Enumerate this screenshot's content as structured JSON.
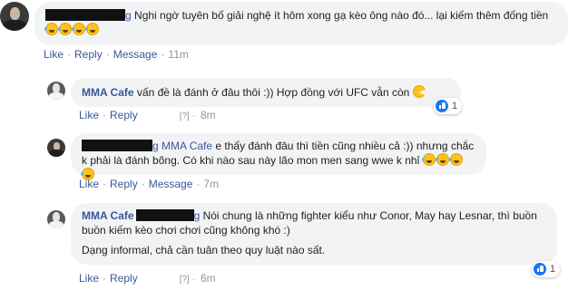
{
  "comments": [
    {
      "text": "Nghi ngờ tuyên bố giải nghệ ít hôm xong gạ kèo ông nào đó... lại kiếm thêm đống tiền",
      "emoji": [
        "rofl",
        "rofl",
        "rofl",
        "rofl"
      ],
      "actions": {
        "like": "Like",
        "reply": "Reply",
        "message": "Message",
        "time": "11m"
      }
    },
    {
      "author": "MMA Cafe",
      "text": "vấn đề là đánh ở đâu thôi :)) Hợp đồng với UFC vẫn còn",
      "emoji": [
        "pacman"
      ],
      "actions": {
        "like": "Like",
        "reply": "Reply",
        "translate_hint": "[?] ·",
        "time": "8m"
      },
      "reaction": {
        "icon": "like-icon",
        "count": "1"
      }
    },
    {
      "tag_suffix": "g",
      "tag": "MMA Cafe",
      "text": "e thấy đánh đâu thì tiền cũng nhiều cả :)) nhưng chắc k phải là đánh bõng. Có khi nào sau này lão mon men sang wwe k nhỉ",
      "emoji": [
        "rofl",
        "rofl",
        "rofl",
        "rofl"
      ],
      "actions": {
        "like": "Like",
        "reply": "Reply",
        "message": "Message",
        "time": "7m"
      }
    },
    {
      "author": "MMA Cafe",
      "tag_suffix": "g",
      "text": "Nói chung là những fighter kiểu như Conor, May hay Lesnar, thì buồn buồn kiếm kèo chơi chơi cũng không khó :)",
      "text2": "Dạng informal, chả cần tuân theo quy luật nào sất.",
      "actions": {
        "like": "Like",
        "reply": "Reply",
        "translate_hint": "[?] ·",
        "time": "6m"
      },
      "reaction": {
        "icon": "like-icon",
        "count": "1"
      }
    }
  ]
}
